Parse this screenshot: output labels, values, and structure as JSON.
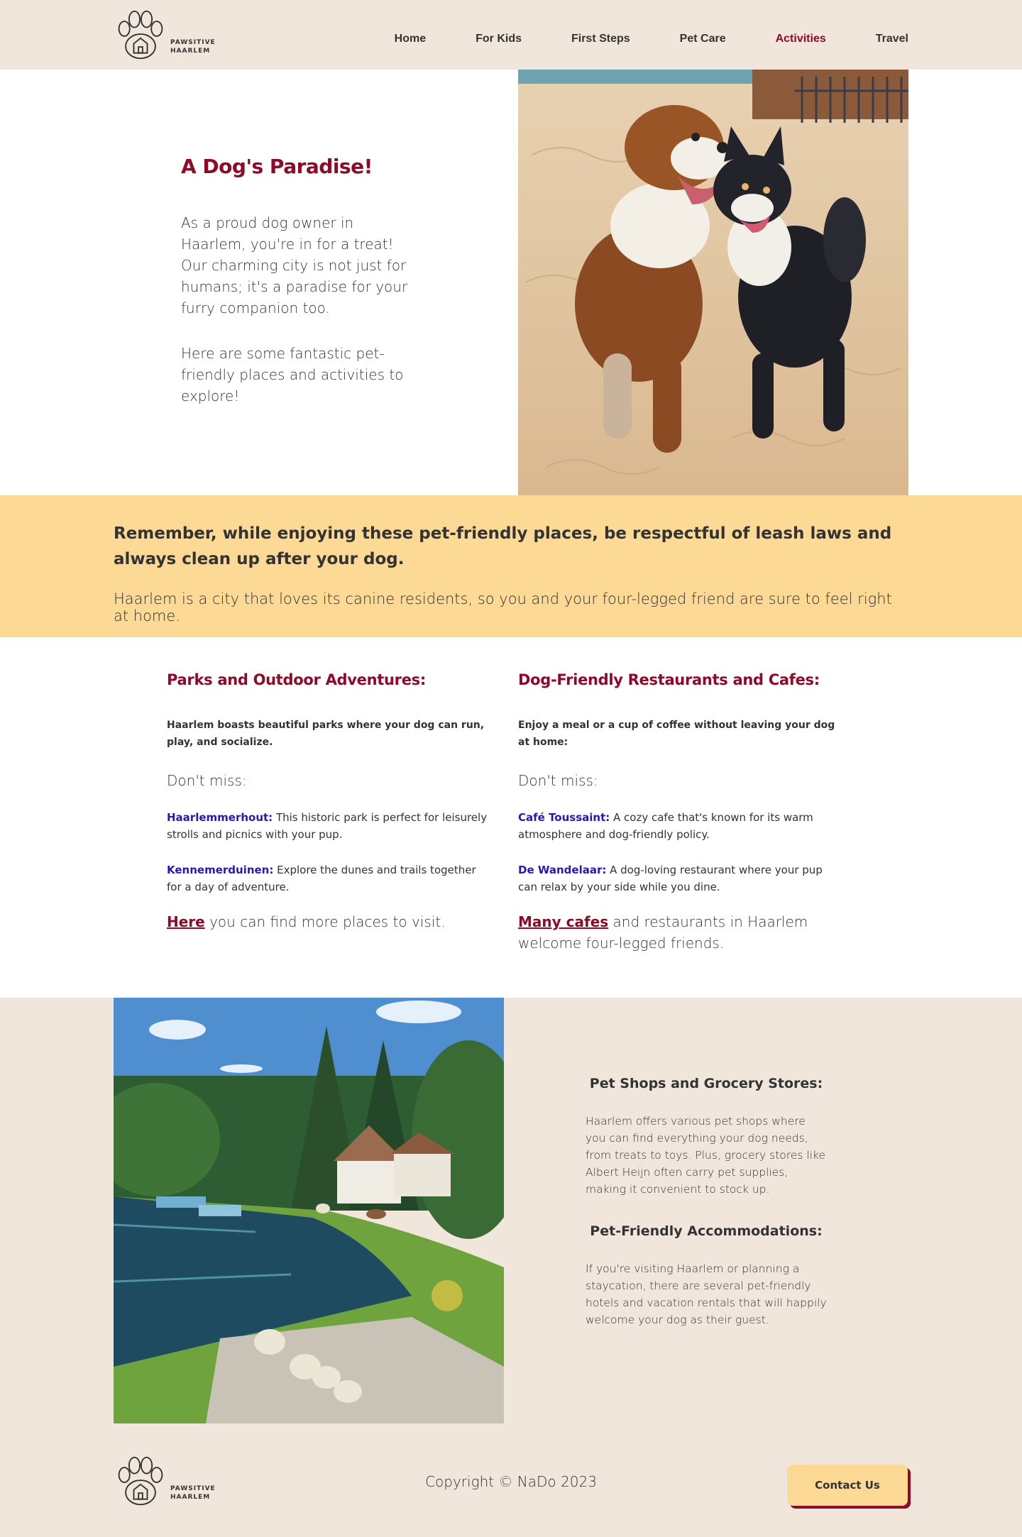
{
  "header": {
    "logo_text_line1": "PAWSITIVE",
    "logo_text_line2": "HAARLEM",
    "nav": [
      {
        "label": "Home"
      },
      {
        "label": "For Kids"
      },
      {
        "label": "First Steps"
      },
      {
        "label": "Pet Care"
      },
      {
        "label": "Activities",
        "active": true
      },
      {
        "label": "Travel"
      }
    ]
  },
  "hero": {
    "title": "A Dog's Paradise!",
    "p1": "As a proud dog owner in Haarlem, you're in for a treat! Our charming city is not just for humans; it's a paradise for your furry companion too.",
    "p2": "Here are some fantastic pet-friendly places and activities to explore!"
  },
  "band": {
    "strong": "Remember, while enjoying these pet-friendly places, be respectful of leash laws and always clean up after your dog.",
    "text": "Haarlem is a city that loves its canine residents, so you and your four-legged friend are sure to feel right at home."
  },
  "parks": {
    "title": "Parks and Outdoor Adventures:",
    "intro": "Haarlem boasts beautiful parks where your dog can run, play, and socialize.",
    "dont_miss": "Don't miss:",
    "items": [
      {
        "name": "Haarlemmerhout:",
        "text": " This historic park is perfect for leisurely strolls and picnics with your pup."
      },
      {
        "name": "Kennemerduinen:",
        "text": " Explore the dunes and trails together for a day of adventure."
      }
    ],
    "more_link": "Here",
    "more_text": " you can find more places to visit."
  },
  "restaurants": {
    "title": "Dog-Friendly Restaurants and Cafes:",
    "intro": "Enjoy a meal or a cup of coffee without leaving your dog at home:",
    "dont_miss": "Don't miss:",
    "items": [
      {
        "name": "Café Toussaint:",
        "text": " A cozy cafe that's known for its warm atmosphere and dog-friendly policy."
      },
      {
        "name": "De Wandelaar:",
        "text": " A dog-loving restaurant where your pup can relax by your side while you dine."
      }
    ],
    "more_link": "Many cafes",
    "more_text": " and restaurants in Haarlem welcome four-legged friends."
  },
  "shops": {
    "title": "Pet Shops and Grocery Stores:",
    "text": "Haarlem offers various pet shops where you can find everything your dog needs, from treats to toys. Plus, grocery stores like Albert Heijn often carry pet supplies, making it convenient to stock up."
  },
  "accommodations": {
    "title": "Pet-Friendly Accommodations:",
    "text": "If you're visiting Haarlem or planning a staycation, there are several pet-friendly hotels and vacation rentals that will happily welcome your dog as their guest."
  },
  "footer": {
    "copyright": "Copyright © NaDo 2023",
    "contact_label": "Contact Us"
  },
  "colors": {
    "accent": "#8f0a28",
    "beige": "#f1e6db",
    "yellow": "#fcd994",
    "link_blue": "#2b16b8"
  }
}
